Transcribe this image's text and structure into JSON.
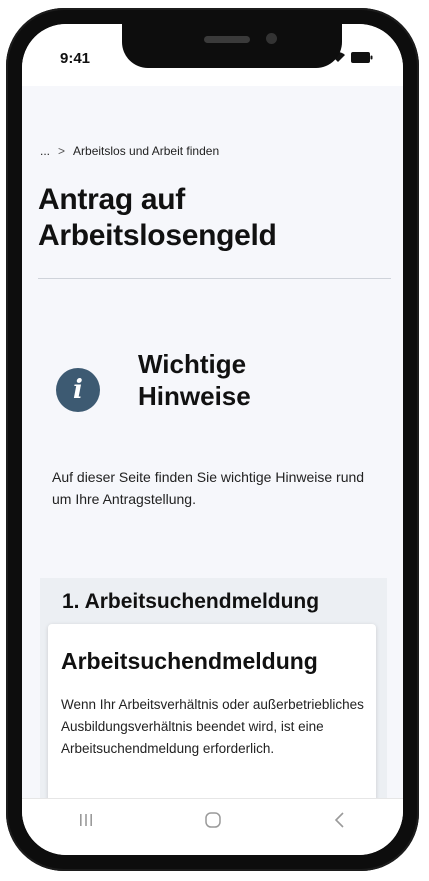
{
  "status_bar": {
    "time": "9:41",
    "icons": [
      "signal-icon",
      "wifi-icon",
      "battery-icon"
    ]
  },
  "breadcrumb": {
    "ellipsis": "...",
    "separator": ">",
    "current": "Arbeitslos und Arbeit finden"
  },
  "page": {
    "title": "Antrag auf Arbeitslosengeld"
  },
  "notice": {
    "icon": "info-icon",
    "icon_glyph": "i",
    "heading": "Wichtige Hinweise",
    "intro": "Auf dieser Seite finden Sie wichtige Hinweise rund um Ihre Antragstellung."
  },
  "step": {
    "title": "1. Arbeitsuchendmeldung",
    "card_title": "Arbeitsuchendmeldung",
    "card_text": "Wenn Ihr Arbeitsverhältnis oder außerbetriebliches Ausbildungsverhältnis beendet wird, ist eine Arbeitsuchendmeldung erforderlich."
  },
  "nav": {
    "items": [
      "recent-apps-icon",
      "home-icon",
      "back-icon"
    ]
  },
  "colors": {
    "info_icon_bg": "#3d5a72",
    "content_bg": "#f6f7fb",
    "step_bg": "#eceff3"
  }
}
